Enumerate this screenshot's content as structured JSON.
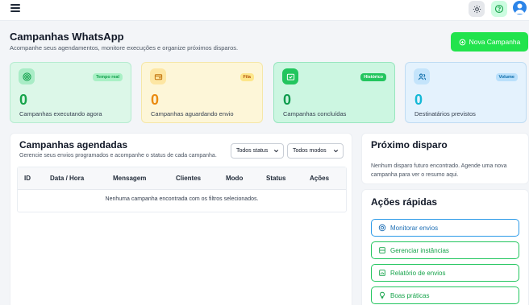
{
  "header": {
    "menu_icon": "hamburger-icon",
    "theme_icon": "sun-icon",
    "help_icon": "question-icon",
    "avatar_icon": "user-avatar"
  },
  "page": {
    "title": "Campanhas WhatsApp",
    "subtitle": "Acompanhe seus agendamentos, monitore execuções e organize próximos disparos.",
    "new_button_label": "Nova Campanha"
  },
  "stats": [
    {
      "badge": "Tempo real",
      "value": "0",
      "label": "Campanhas executando agora",
      "icon": "radio-signal-icon"
    },
    {
      "badge": "Fila",
      "value": "0",
      "label": "Campanhas aguardando envio",
      "icon": "wallet-icon"
    },
    {
      "badge": "Histórico",
      "value": "0",
      "label": "Campanhas concluídas",
      "icon": "folder-check-icon"
    },
    {
      "badge": "Volume",
      "value": "0",
      "label": "Destinatários previstos",
      "icon": "users-icon"
    }
  ],
  "schedule": {
    "title": "Campanhas agendadas",
    "subtitle": "Gerencie seus envios programados e acompanhe o status de cada campanha.",
    "filter_status": "Todos status",
    "filter_mode": "Todos modos",
    "columns": [
      "ID",
      "Data / Hora",
      "Mensagem",
      "Clientes",
      "Modo",
      "Status",
      "Ações"
    ],
    "empty_message": "Nenhuma campanha encontrada com os filtros selecionados."
  },
  "next_dispatch": {
    "title": "Próximo disparo",
    "body": "Nenhum disparo futuro encontrado. Agende uma nova campanha para ver o resumo aqui."
  },
  "quick_actions": {
    "title": "Ações rápidas",
    "items": [
      {
        "label": "Monitorar envios",
        "icon": "monitor-icon"
      },
      {
        "label": "Gerenciar instâncias",
        "icon": "server-icon"
      },
      {
        "label": "Relatório de envios",
        "icon": "report-icon"
      },
      {
        "label": "Boas práticas",
        "icon": "lightbulb-icon"
      }
    ]
  },
  "colors": {
    "accent": "#22e34d",
    "text": "#1f2937",
    "background": "#f3f5f8"
  }
}
